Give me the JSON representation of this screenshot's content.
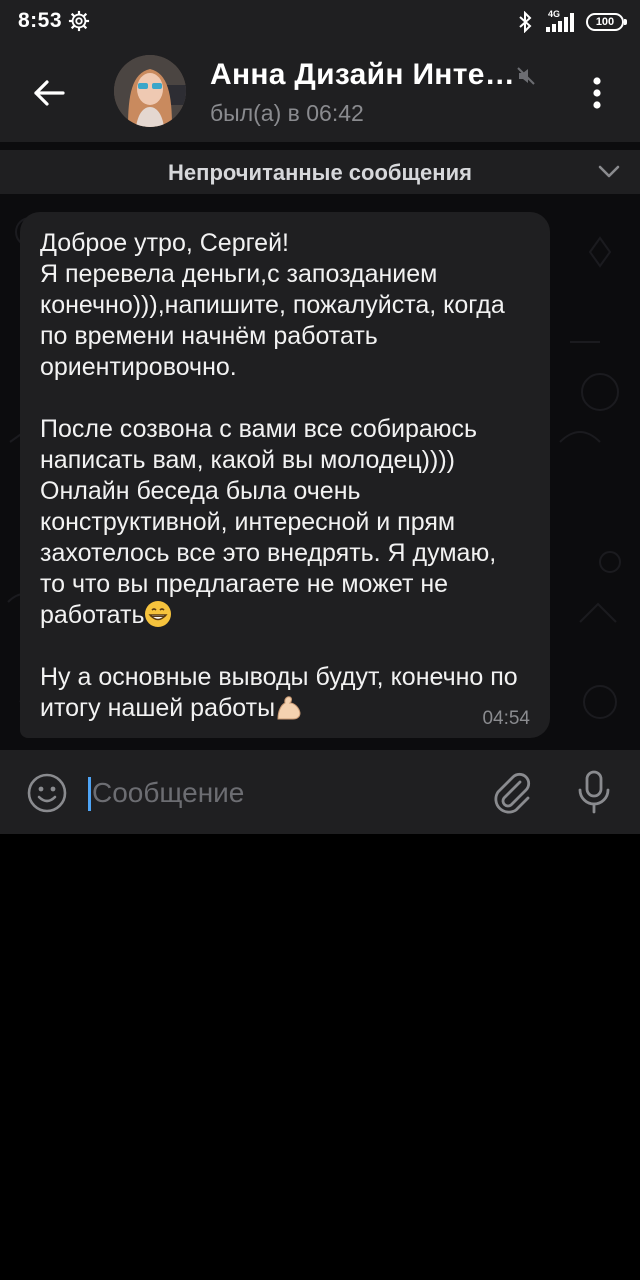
{
  "status_bar": {
    "time": "8:53",
    "network": "4G",
    "battery": "100"
  },
  "header": {
    "chat_name": "Анна Дизайн Инте…",
    "last_seen": "был(а) в 06:42"
  },
  "unread_banner": {
    "label": "Непрочитанные сообщения"
  },
  "message": {
    "paragraph1_line1": "Доброе утро, Сергей!",
    "paragraph1_line2": "Я перевела деньги,с запозданием конечно))),напишите, пожалуйста, когда по времени начнём работать ориентировочно.",
    "paragraph2": "После созвона с вами все собираюсь написать вам, какой вы молодец)))) Онлайн беседа была очень конструктивной, интересной и прям захотелось все это внедрять. Я думаю, то что вы предлагаете не может не работать",
    "paragraph3": "Ну а основные выводы будут, конечно по итогу нашей работы",
    "emoji_grin": "grinning-face-emoji",
    "emoji_muscle": "flexed-biceps-emoji",
    "time": "04:54"
  },
  "composer": {
    "placeholder": "Сообщение",
    "value": ""
  },
  "colors": {
    "background": "#000000",
    "bar": "#1f1f21",
    "bubble": "#1f1f21",
    "chat_bg": "#0c0c0e",
    "secondary_text": "#8a8b8f",
    "caret": "#4ea4f6"
  },
  "icons": {
    "back": "arrow-left-icon",
    "menu": "more-vertical-icon",
    "mute": "muted-icon",
    "chevron": "chevron-down-icon",
    "emoji": "smile-icon",
    "attach": "paperclip-icon",
    "mic": "microphone-icon"
  }
}
